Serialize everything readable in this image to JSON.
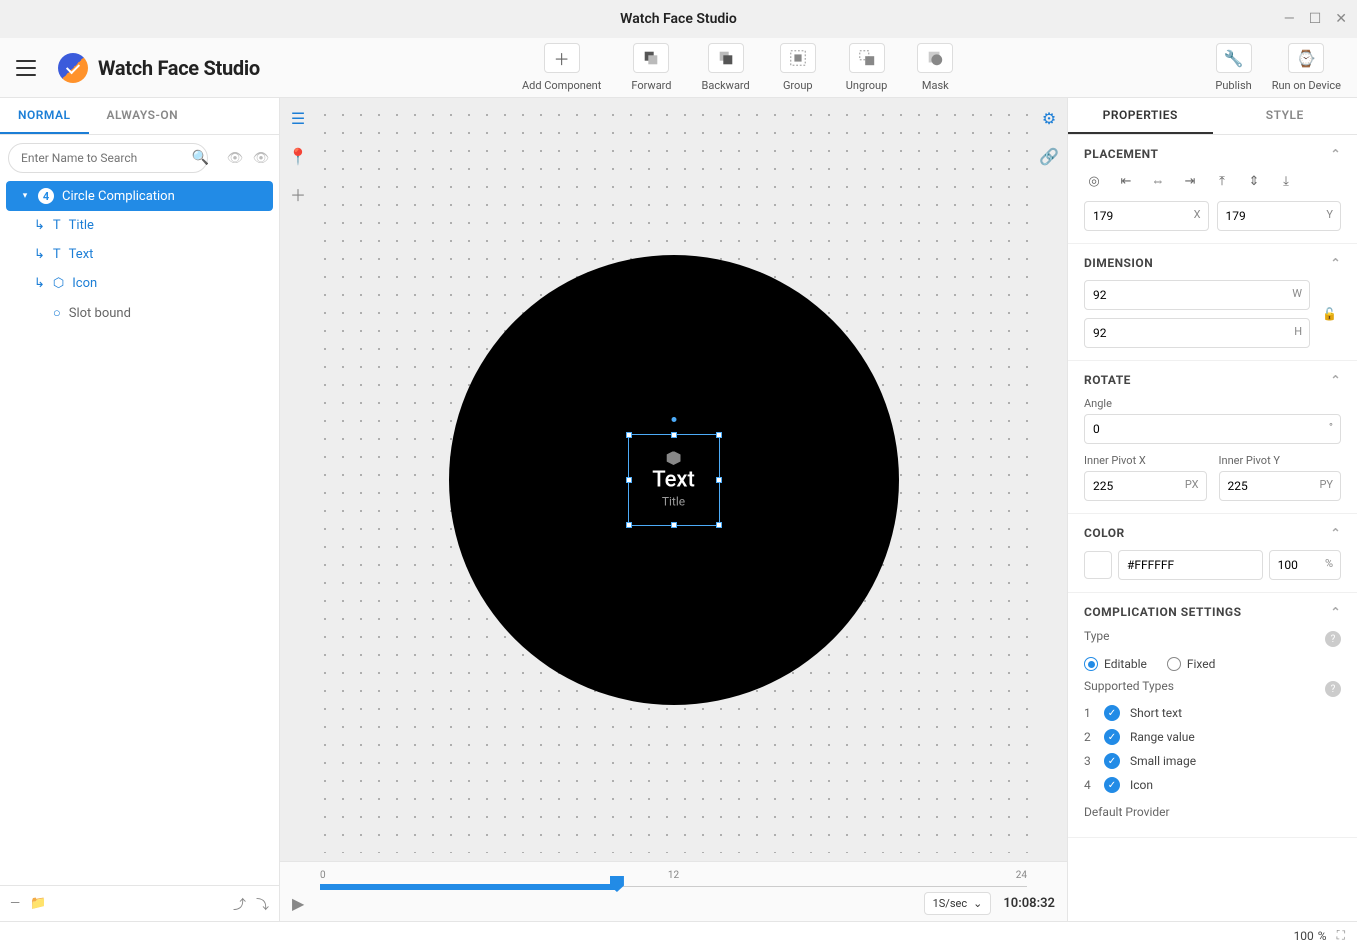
{
  "window": {
    "title": "Watch Face Studio"
  },
  "brand": {
    "name": "Watch Face Studio"
  },
  "toolbar": {
    "add": "Add Component",
    "forward": "Forward",
    "backward": "Backward",
    "group": "Group",
    "ungroup": "Ungroup",
    "mask": "Mask",
    "publish": "Publish",
    "run": "Run on Device"
  },
  "leftTabs": {
    "normal": "NORMAL",
    "always": "ALWAYS-ON"
  },
  "search": {
    "placeholder": "Enter Name to Search"
  },
  "layers": {
    "root": "Circle Complication",
    "rootBadge": "4",
    "children": [
      {
        "label": "Title"
      },
      {
        "label": "Text"
      },
      {
        "label": "Icon"
      },
      {
        "label": "Slot bound"
      }
    ]
  },
  "canvas": {
    "compText": "Text",
    "compTitle": "Title",
    "timeline": {
      "start": "0",
      "mid": "12",
      "end": "24"
    },
    "rate": "1S/sec",
    "clock": "10:08:32"
  },
  "rightTabs": {
    "properties": "PROPERTIES",
    "style": "STYLE"
  },
  "props": {
    "placement": {
      "title": "PLACEMENT",
      "x": "179",
      "y": "179"
    },
    "dimension": {
      "title": "DIMENSION",
      "w": "92",
      "h": "92"
    },
    "rotate": {
      "title": "ROTATE",
      "angleLabel": "Angle",
      "angle": "0",
      "pxLabel": "Inner Pivot X",
      "pyLabel": "Inner Pivot Y",
      "px": "225",
      "py": "225"
    },
    "color": {
      "title": "COLOR",
      "hex": "#FFFFFF",
      "opacity": "100"
    },
    "comp": {
      "title": "COMPLICATION SETTINGS",
      "typeLabel": "Type",
      "editable": "Editable",
      "fixed": "Fixed",
      "supportedLabel": "Supported Types",
      "types": [
        "Short text",
        "Range value",
        "Small image",
        "Icon"
      ],
      "providerLabel": "Default Provider"
    }
  },
  "status": {
    "zoom": "100",
    "unit": "%"
  }
}
